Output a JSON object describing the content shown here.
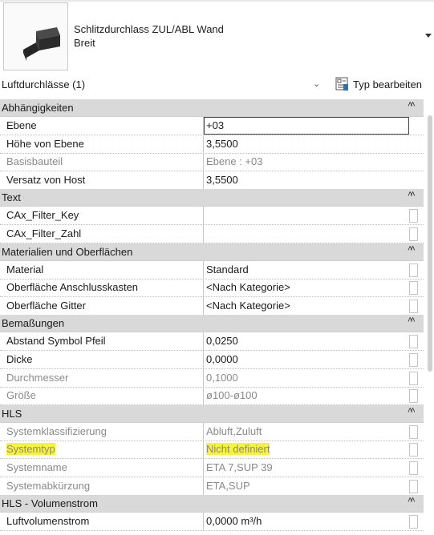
{
  "type_selector": {
    "family": "Schlitzdurchlass ZUL/ABL Wand",
    "type": "Breit"
  },
  "category_filter": "Luftdurchlässe (1)",
  "edit_type_label": "Typ bearbeiten",
  "groups": [
    {
      "label": "Abhängigkeiten",
      "rows": [
        {
          "name": "Ebene",
          "value": "+03",
          "readonly": false,
          "editing": true
        },
        {
          "name": "Höhe von Ebene",
          "value": "3,5500",
          "readonly": false
        },
        {
          "name": "Basisbauteil",
          "value": "Ebene : +03",
          "readonly": true
        },
        {
          "name": "Versatz von Host",
          "value": "3,5500",
          "readonly": false
        }
      ]
    },
    {
      "label": "Text",
      "rows": [
        {
          "name": "CAx_Filter_Key",
          "value": "",
          "readonly": false,
          "button": true
        },
        {
          "name": "CAx_Filter_Zahl",
          "value": "",
          "readonly": false,
          "button": true
        }
      ]
    },
    {
      "label": "Materialien und Oberflächen",
      "rows": [
        {
          "name": "Material",
          "value": "Standard",
          "readonly": false,
          "button": true
        },
        {
          "name": "Oberfläche Anschlusskasten",
          "value": "<Nach Kategorie>",
          "readonly": false,
          "button": true
        },
        {
          "name": "Oberfläche Gitter",
          "value": "<Nach Kategorie>",
          "readonly": false,
          "button": true
        }
      ]
    },
    {
      "label": "Bemaßungen",
      "rows": [
        {
          "name": "Abstand Symbol Pfeil",
          "value": "0,0250",
          "readonly": false,
          "button": true
        },
        {
          "name": "Dicke",
          "value": "0,0000",
          "readonly": false,
          "button": true
        },
        {
          "name": "Durchmesser",
          "value": "0,1000",
          "readonly": true,
          "button": true
        },
        {
          "name": "Größe",
          "value": "ø100-ø100",
          "readonly": true,
          "button": true
        }
      ]
    },
    {
      "label": "HLS",
      "rows": [
        {
          "name": "Systemklassifizierung",
          "value": "Abluft,Zuluft",
          "readonly": true,
          "button": true
        },
        {
          "name": "Systemtyp",
          "value": "Nicht definiert",
          "readonly": true,
          "highlight": true,
          "button": true
        },
        {
          "name": "Systemname",
          "value": "ETA 7,SUP 39",
          "readonly": true,
          "button": true
        },
        {
          "name": "Systemabkürzung",
          "value": "ETA,SUP",
          "readonly": true,
          "button": true
        }
      ]
    },
    {
      "label": "HLS - Volumenstrom",
      "rows": [
        {
          "name": "Luftvolumenstrom",
          "value": "0,0000 m³/h",
          "readonly": false,
          "button": true
        }
      ]
    }
  ],
  "icons": {
    "collapse": "double-chevron-up-icon",
    "dropdown": "chevron-down-icon",
    "edit_type": "edit-type-icon"
  }
}
